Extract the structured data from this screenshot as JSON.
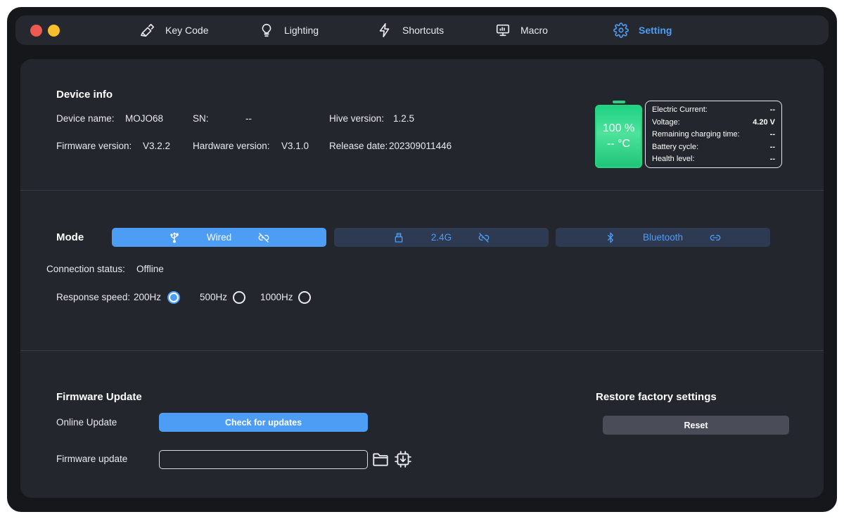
{
  "nav": {
    "items": [
      {
        "label": "Key Code",
        "icon": "key-code-icon"
      },
      {
        "label": "Lighting",
        "icon": "bulb-icon"
      },
      {
        "label": "Shortcuts",
        "icon": "lightning-icon"
      },
      {
        "label": "Macro",
        "icon": "monitor-icon"
      },
      {
        "label": "Setting",
        "icon": "gear-icon"
      }
    ],
    "active": "Setting"
  },
  "device_info": {
    "title": "Device info",
    "device_name_label": "Device name:",
    "device_name": "MOJO68",
    "sn_label": "SN:",
    "sn": "--",
    "hive_label": "Hive version:",
    "hive": "1.2.5",
    "firmware_label": "Firmware version:",
    "firmware": "V3.2.2",
    "hardware_label": "Hardware version:",
    "hardware": "V3.1.0",
    "release_label": "Release date:",
    "release": "202309011446"
  },
  "battery": {
    "percent_text": "100 %",
    "temp_text": "-- °C",
    "level": 1.0,
    "color": "#2bd17e",
    "rows": [
      {
        "label": "Electric Current:",
        "value": "--"
      },
      {
        "label": "Voltage:",
        "value": "4.20 V"
      },
      {
        "label": "Remaining charging time:",
        "value": "--"
      },
      {
        "label": "Battery cycle:",
        "value": "--"
      },
      {
        "label": "Health level:",
        "value": "--"
      }
    ]
  },
  "mode": {
    "title": "Mode",
    "options": [
      {
        "label": "Wired",
        "icon": "usb-icon",
        "status_icon": "unlink-icon",
        "active": true
      },
      {
        "label": "2.4G",
        "icon": "receiver-icon",
        "status_icon": "unlink-icon",
        "active": false
      },
      {
        "label": "Bluetooth",
        "icon": "bluetooth-icon",
        "status_icon": "link-icon",
        "active": false
      }
    ],
    "connection_label": "Connection status:",
    "connection_value": "Offline",
    "speed_label": "Response speed:",
    "speeds": [
      "200Hz",
      "500Hz",
      "1000Hz"
    ],
    "selected_speed": "200Hz"
  },
  "firmware": {
    "title": "Firmware Update",
    "online_label": "Online Update",
    "check_button": "Check for updates",
    "file_label": "Firmware update",
    "file_value": ""
  },
  "restore": {
    "title": "Restore factory settings",
    "reset_button": "Reset"
  },
  "colors": {
    "accent": "#4d9df5",
    "battery": "#2bd17e",
    "close": "#ed5a52",
    "minimize": "#f5c02c"
  }
}
